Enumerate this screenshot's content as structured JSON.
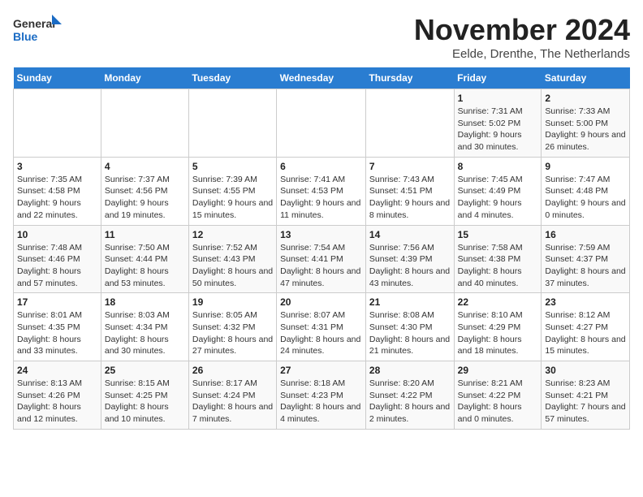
{
  "logo": {
    "general": "General",
    "blue": "Blue"
  },
  "title": "November 2024",
  "subtitle": "Eelde, Drenthe, The Netherlands",
  "days_of_week": [
    "Sunday",
    "Monday",
    "Tuesday",
    "Wednesday",
    "Thursday",
    "Friday",
    "Saturday"
  ],
  "weeks": [
    [
      {
        "day": "",
        "info": ""
      },
      {
        "day": "",
        "info": ""
      },
      {
        "day": "",
        "info": ""
      },
      {
        "day": "",
        "info": ""
      },
      {
        "day": "",
        "info": ""
      },
      {
        "day": "1",
        "info": "Sunrise: 7:31 AM\nSunset: 5:02 PM\nDaylight: 9 hours and 30 minutes."
      },
      {
        "day": "2",
        "info": "Sunrise: 7:33 AM\nSunset: 5:00 PM\nDaylight: 9 hours and 26 minutes."
      }
    ],
    [
      {
        "day": "3",
        "info": "Sunrise: 7:35 AM\nSunset: 4:58 PM\nDaylight: 9 hours and 22 minutes."
      },
      {
        "day": "4",
        "info": "Sunrise: 7:37 AM\nSunset: 4:56 PM\nDaylight: 9 hours and 19 minutes."
      },
      {
        "day": "5",
        "info": "Sunrise: 7:39 AM\nSunset: 4:55 PM\nDaylight: 9 hours and 15 minutes."
      },
      {
        "day": "6",
        "info": "Sunrise: 7:41 AM\nSunset: 4:53 PM\nDaylight: 9 hours and 11 minutes."
      },
      {
        "day": "7",
        "info": "Sunrise: 7:43 AM\nSunset: 4:51 PM\nDaylight: 9 hours and 8 minutes."
      },
      {
        "day": "8",
        "info": "Sunrise: 7:45 AM\nSunset: 4:49 PM\nDaylight: 9 hours and 4 minutes."
      },
      {
        "day": "9",
        "info": "Sunrise: 7:47 AM\nSunset: 4:48 PM\nDaylight: 9 hours and 0 minutes."
      }
    ],
    [
      {
        "day": "10",
        "info": "Sunrise: 7:48 AM\nSunset: 4:46 PM\nDaylight: 8 hours and 57 minutes."
      },
      {
        "day": "11",
        "info": "Sunrise: 7:50 AM\nSunset: 4:44 PM\nDaylight: 8 hours and 53 minutes."
      },
      {
        "day": "12",
        "info": "Sunrise: 7:52 AM\nSunset: 4:43 PM\nDaylight: 8 hours and 50 minutes."
      },
      {
        "day": "13",
        "info": "Sunrise: 7:54 AM\nSunset: 4:41 PM\nDaylight: 8 hours and 47 minutes."
      },
      {
        "day": "14",
        "info": "Sunrise: 7:56 AM\nSunset: 4:39 PM\nDaylight: 8 hours and 43 minutes."
      },
      {
        "day": "15",
        "info": "Sunrise: 7:58 AM\nSunset: 4:38 PM\nDaylight: 8 hours and 40 minutes."
      },
      {
        "day": "16",
        "info": "Sunrise: 7:59 AM\nSunset: 4:37 PM\nDaylight: 8 hours and 37 minutes."
      }
    ],
    [
      {
        "day": "17",
        "info": "Sunrise: 8:01 AM\nSunset: 4:35 PM\nDaylight: 8 hours and 33 minutes."
      },
      {
        "day": "18",
        "info": "Sunrise: 8:03 AM\nSunset: 4:34 PM\nDaylight: 8 hours and 30 minutes."
      },
      {
        "day": "19",
        "info": "Sunrise: 8:05 AM\nSunset: 4:32 PM\nDaylight: 8 hours and 27 minutes."
      },
      {
        "day": "20",
        "info": "Sunrise: 8:07 AM\nSunset: 4:31 PM\nDaylight: 8 hours and 24 minutes."
      },
      {
        "day": "21",
        "info": "Sunrise: 8:08 AM\nSunset: 4:30 PM\nDaylight: 8 hours and 21 minutes."
      },
      {
        "day": "22",
        "info": "Sunrise: 8:10 AM\nSunset: 4:29 PM\nDaylight: 8 hours and 18 minutes."
      },
      {
        "day": "23",
        "info": "Sunrise: 8:12 AM\nSunset: 4:27 PM\nDaylight: 8 hours and 15 minutes."
      }
    ],
    [
      {
        "day": "24",
        "info": "Sunrise: 8:13 AM\nSunset: 4:26 PM\nDaylight: 8 hours and 12 minutes."
      },
      {
        "day": "25",
        "info": "Sunrise: 8:15 AM\nSunset: 4:25 PM\nDaylight: 8 hours and 10 minutes."
      },
      {
        "day": "26",
        "info": "Sunrise: 8:17 AM\nSunset: 4:24 PM\nDaylight: 8 hours and 7 minutes."
      },
      {
        "day": "27",
        "info": "Sunrise: 8:18 AM\nSunset: 4:23 PM\nDaylight: 8 hours and 4 minutes."
      },
      {
        "day": "28",
        "info": "Sunrise: 8:20 AM\nSunset: 4:22 PM\nDaylight: 8 hours and 2 minutes."
      },
      {
        "day": "29",
        "info": "Sunrise: 8:21 AM\nSunset: 4:22 PM\nDaylight: 8 hours and 0 minutes."
      },
      {
        "day": "30",
        "info": "Sunrise: 8:23 AM\nSunset: 4:21 PM\nDaylight: 7 hours and 57 minutes."
      }
    ]
  ]
}
